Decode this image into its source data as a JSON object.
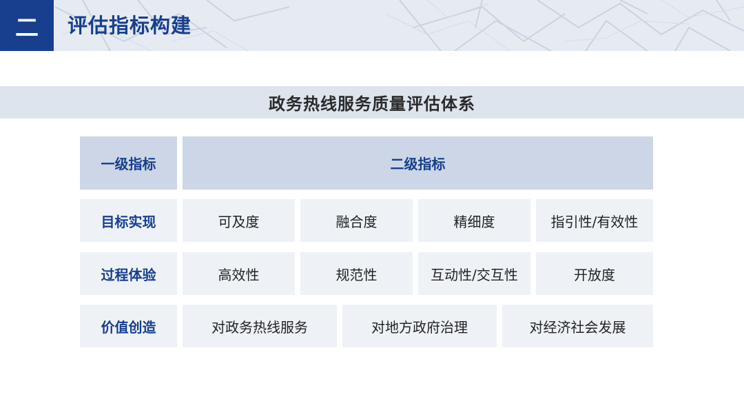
{
  "header": {
    "section_number": "二",
    "title": "评估指标构建"
  },
  "banner": {
    "title": "政务热线服务质量评估体系"
  },
  "table": {
    "headers": {
      "level1": "一级指标",
      "level2": "二级指标"
    },
    "rows": [
      {
        "level1": "目标实现",
        "level2": [
          "可及度",
          "融合度",
          "精细度",
          "指引性/有效性"
        ]
      },
      {
        "level1": "过程体验",
        "level2": [
          "高效性",
          "规范性",
          "互动性/交互性",
          "开放度"
        ]
      },
      {
        "level1": "价值创造",
        "level2": [
          "对政务热线服务",
          "对地方政府治理",
          "对经济社会发展"
        ]
      }
    ]
  },
  "colors": {
    "brand_blue": "#173f8d",
    "header_bg": "#e6ebf2",
    "banner_bg": "#dde4ee",
    "head_cell_bg": "#ccd6e6",
    "cell_bg": "#eef2f7"
  }
}
